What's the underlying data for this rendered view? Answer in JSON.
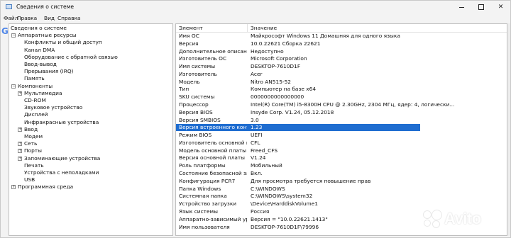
{
  "window": {
    "title": "Сведения о системе"
  },
  "menu": [
    "Файл",
    "Правка",
    "Вид",
    "Справка"
  ],
  "tree": [
    {
      "label": "Сведения о системе",
      "level": 0,
      "expander": ""
    },
    {
      "label": "Аппаратные ресурсы",
      "level": 1,
      "expander": "−"
    },
    {
      "label": "Конфликты и общий доступ",
      "level": 2,
      "expander": ""
    },
    {
      "label": "Канал DMA",
      "level": 2,
      "expander": ""
    },
    {
      "label": "Оборудование с обратной связью",
      "level": 2,
      "expander": ""
    },
    {
      "label": "Ввод-вывод",
      "level": 2,
      "expander": ""
    },
    {
      "label": "Прерывания (IRQ)",
      "level": 2,
      "expander": ""
    },
    {
      "label": "Память",
      "level": 2,
      "expander": ""
    },
    {
      "label": "Компоненты",
      "level": 1,
      "expander": "−"
    },
    {
      "label": "Мультимедиа",
      "level": 2,
      "expander": "+"
    },
    {
      "label": "CD-ROM",
      "level": 2,
      "expander": ""
    },
    {
      "label": "Звуковое устройство",
      "level": 2,
      "expander": ""
    },
    {
      "label": "Дисплей",
      "level": 2,
      "expander": ""
    },
    {
      "label": "Инфракрасные устройства",
      "level": 2,
      "expander": ""
    },
    {
      "label": "Ввод",
      "level": 2,
      "expander": "+"
    },
    {
      "label": "Модем",
      "level": 2,
      "expander": ""
    },
    {
      "label": "Сеть",
      "level": 2,
      "expander": "+"
    },
    {
      "label": "Порты",
      "level": 2,
      "expander": "+"
    },
    {
      "label": "Запоминающие устройства",
      "level": 2,
      "expander": "+"
    },
    {
      "label": "Печать",
      "level": 2,
      "expander": ""
    },
    {
      "label": "Устройства с неполадками",
      "level": 2,
      "expander": ""
    },
    {
      "label": "USB",
      "level": 2,
      "expander": ""
    },
    {
      "label": "Программная среда",
      "level": 1,
      "expander": "+"
    }
  ],
  "list": {
    "headers": [
      "Элемент",
      "Значение"
    ],
    "selected_index": 14,
    "rows": [
      [
        "Имя ОС",
        "Майкрософт Windows 11 Домашняя для одного языка"
      ],
      [
        "Версия",
        "10.0.22621 Сборка 22621"
      ],
      [
        "Дополнительное описание ...",
        "Недоступно"
      ],
      [
        "Изготовитель ОС",
        "Microsoft Corporation"
      ],
      [
        "Имя системы",
        "DESKTOP-7610D1F"
      ],
      [
        "Изготовитель",
        "Acer"
      ],
      [
        "Модель",
        "Nitro AN515-52"
      ],
      [
        "Тип",
        "Компьютер на базе x64"
      ],
      [
        "SKU системы",
        "0000000000000000"
      ],
      [
        "Процессор",
        "Intel(R) Core(TM) i5-8300H CPU @ 2.30GHz, 2304 МГц, ядер: 4, логически..."
      ],
      [
        "Версия BIOS",
        "Insyde Corp. V1.24, 05.12.2018"
      ],
      [
        "Версия SMBIOS",
        "3.0"
      ],
      [
        "Версия встроенного контрол...",
        "1.23"
      ],
      [
        "Режим BIOS",
        "UEFI"
      ],
      [
        "Изготовитель основной платы",
        "CFL"
      ],
      [
        "Модель основной платы",
        "Freed_CFS"
      ],
      [
        "Версия основной платы",
        "V1.24"
      ],
      [
        "Роль платформы",
        "Мобильный"
      ],
      [
        "Состояние безопасной загру...",
        "Вкл."
      ],
      [
        "Конфигурация PCR7",
        "Для просмотра требуется повышение прав"
      ],
      [
        "Папка Windows",
        "C:\\WINDOWS"
      ],
      [
        "Системная папка",
        "C:\\WINDOWS\\system32"
      ],
      [
        "Устройство загрузки",
        "\\Device\\HarddiskVolume1"
      ],
      [
        "Язык системы",
        "Россия"
      ],
      [
        "Аппаратно-зависимый уров...",
        "Версия = \"10.0.22621.1413\""
      ],
      [
        "Имя пользователя",
        "DESKTOP-7610D1F\\79996"
      ]
    ]
  },
  "watermark": {
    "text": "Avito"
  },
  "colors": {
    "selection": "#1f6dd0",
    "background_letter": "#4f86e8"
  },
  "background_letter": "G"
}
